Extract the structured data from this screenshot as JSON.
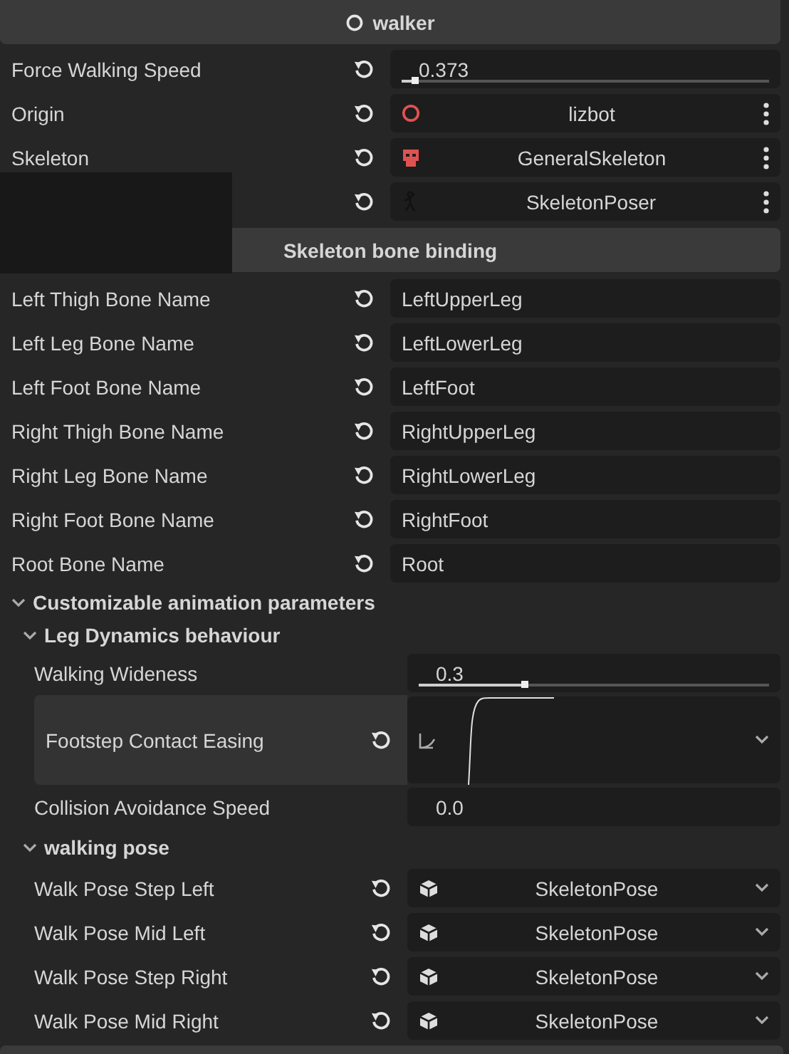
{
  "header": {
    "title": "walker"
  },
  "properties": [
    {
      "kind": "slider",
      "label": "Force Walking Speed",
      "reset": true,
      "value": "0.373"
    },
    {
      "kind": "node",
      "label": "Origin",
      "reset": true,
      "value": "lizbot"
    },
    {
      "kind": "node",
      "label": "Skeleton",
      "reset": true,
      "value": "GeneralSkeleton"
    },
    {
      "kind": "node",
      "reset": true,
      "value": "SkeletonPoser"
    }
  ],
  "section": {
    "title": "Skeleton bone binding"
  },
  "bindings": [
    {
      "kind": "text",
      "label": "Left Thigh Bone Name",
      "reset": true,
      "value": "LeftUpperLeg"
    },
    {
      "kind": "text",
      "label": "Left Leg Bone Name",
      "reset": true,
      "value": "LeftLowerLeg"
    },
    {
      "kind": "text",
      "label": "Left Foot Bone Name",
      "reset": true,
      "value": "LeftFoot"
    },
    {
      "kind": "text",
      "label": "Right Thigh Bone Name",
      "reset": true,
      "value": "RightUpperLeg"
    },
    {
      "kind": "text",
      "label": "Right Leg Bone Name",
      "reset": true,
      "value": "RightLowerLeg"
    },
    {
      "kind": "text",
      "label": "Right Foot Bone Name",
      "reset": true,
      "value": "RightFoot"
    },
    {
      "kind": "text",
      "label": "Root Bone Name",
      "reset": true,
      "value": "Root"
    }
  ],
  "group": {
    "title": "Customizable animation parameters",
    "expanded": true,
    "children": [
      {
        "title": "Leg Dynamics behaviour",
        "expanded": true,
        "properties": [
          {
            "kind": "slider",
            "label": "Walking Wideness",
            "reset": false,
            "value": "0.3",
            "level": 0.3
          },
          {
            "kind": "curve",
            "label": "Footstep Contact Easing",
            "reset": true,
            "selected": true
          },
          {
            "kind": "number",
            "label": "Collision Avoidance Speed",
            "reset": false,
            "value": "0.0"
          }
        ]
      },
      {
        "title": "walking pose",
        "expanded": true,
        "properties": [
          {
            "kind": "resource",
            "label": "Walk Pose Step Left",
            "reset": true,
            "value": "SkeletonPose"
          },
          {
            "kind": "resource",
            "label": "Walk Pose Mid Left",
            "reset": true,
            "value": "SkeletonPose"
          },
          {
            "kind": "resource",
            "label": "Walk Pose Step Right",
            "reset": true,
            "value": "SkeletonPose"
          },
          {
            "kind": "resource",
            "label": "Walk Pose Mid Right",
            "reset": true,
            "value": "SkeletonPose"
          }
        ]
      }
    ]
  }
}
